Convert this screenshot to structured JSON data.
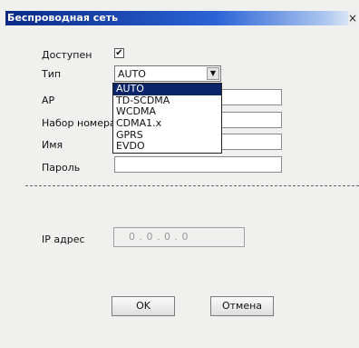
{
  "window": {
    "title": "Беспроводная сеть",
    "close_icon": "close-icon"
  },
  "form": {
    "enabled": {
      "label": "Доступен",
      "checked": true,
      "mark": "✔"
    },
    "type": {
      "label": "Тип",
      "value": "AUTO",
      "options": [
        "AUTO",
        "TD-SCDMA",
        "WCDMA",
        "CDMA1.x",
        "GPRS",
        "EVDO"
      ],
      "selected_index": 0
    },
    "ap": {
      "label": "AP",
      "value": ""
    },
    "dial": {
      "label": "Набор номера",
      "value": ""
    },
    "name": {
      "label": "Имя",
      "value": ""
    },
    "password": {
      "label": "Пароль",
      "value": ""
    },
    "ip": {
      "label": "IP адрес",
      "value": "0 . 0 . 0 . 0"
    }
  },
  "buttons": {
    "ok": "OK",
    "cancel": "Отмена"
  }
}
